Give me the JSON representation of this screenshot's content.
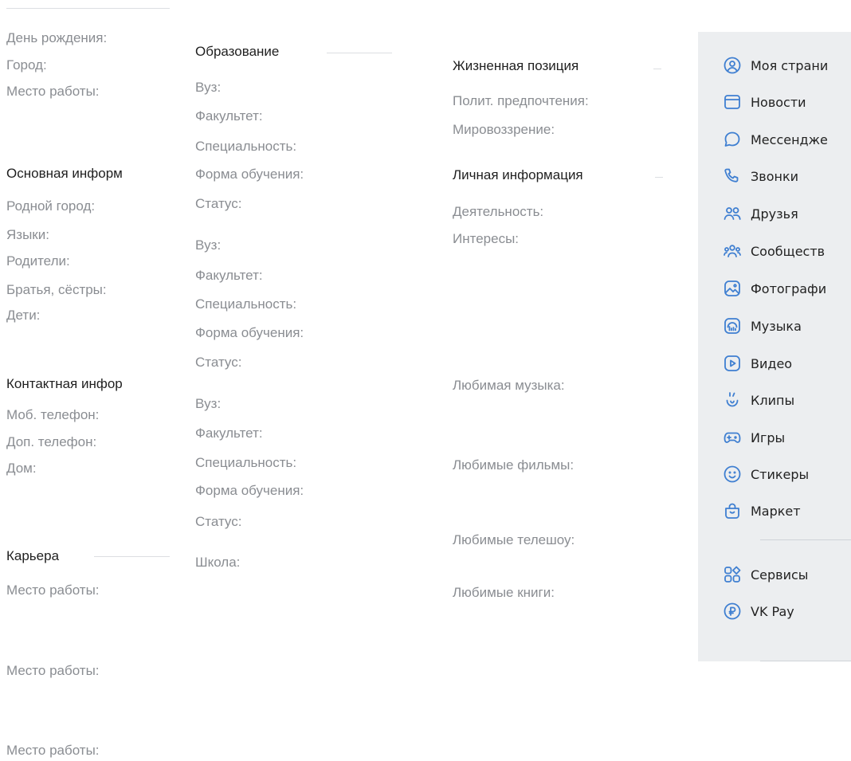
{
  "col1": {
    "top": [
      "День рождения:",
      "Город:",
      "Место работы:"
    ],
    "basic_title": "Основная информ",
    "basic": [
      "Родной город:",
      "Языки:",
      "Родители:",
      "Братья, сёстры:",
      "Дети:"
    ],
    "contact_title": "Контактная инфор",
    "contact": [
      "Моб. телефон:",
      "Доп. телефон:",
      "Дом:"
    ],
    "career_title": "Карьера",
    "career": [
      "Место работы:",
      "Место работы:",
      "Место работы:"
    ]
  },
  "col2": {
    "title": "Образование",
    "uni_blocks": [
      [
        "Вуз:",
        "Факультет:",
        "Специальность:",
        "Форма обучения:",
        "Статус:"
      ],
      [
        "Вуз:",
        "Факультет:",
        "Специальность:",
        "Форма обучения:",
        "Статус:"
      ],
      [
        "Вуз:",
        "Факультет:",
        "Специальность:",
        "Форма обучения:",
        "Статус:"
      ]
    ],
    "school": "Школа:"
  },
  "col3": {
    "life_title": "Жизненная позиция",
    "life": [
      "Полит. предпочтения:",
      "Мировоззрение:"
    ],
    "personal_title": "Личная информация",
    "personal": [
      "Деятельность:",
      "Интересы:",
      "Любимая музыка:",
      "Любимые фильмы:",
      "Любимые телешоу:",
      "Любимые книги:"
    ]
  },
  "menu": {
    "accent_color": "#3f7fd1",
    "items": [
      {
        "label": "Моя страни",
        "icon": "user-circle-icon"
      },
      {
        "label": "Новости",
        "icon": "newspaper-icon"
      },
      {
        "label": "Мессендже",
        "icon": "chat-bubble-icon"
      },
      {
        "label": "Звонки",
        "icon": "phone-icon"
      },
      {
        "label": "Друзья",
        "icon": "friends-icon"
      },
      {
        "label": "Сообществ",
        "icon": "communities-icon"
      },
      {
        "label": "Фотографи",
        "icon": "photo-icon"
      },
      {
        "label": "Музыка",
        "icon": "music-icon"
      },
      {
        "label": "Видео",
        "icon": "video-icon"
      },
      {
        "label": "Клипы",
        "icon": "clips-icon"
      },
      {
        "label": "Игры",
        "icon": "gamepad-icon"
      },
      {
        "label": "Стикеры",
        "icon": "sticker-icon"
      },
      {
        "label": "Маркет",
        "icon": "market-bag-icon"
      },
      {
        "label": "Сервисы",
        "icon": "services-grid-icon"
      },
      {
        "label": "VK Pay",
        "icon": "vk-pay-icon"
      }
    ]
  }
}
